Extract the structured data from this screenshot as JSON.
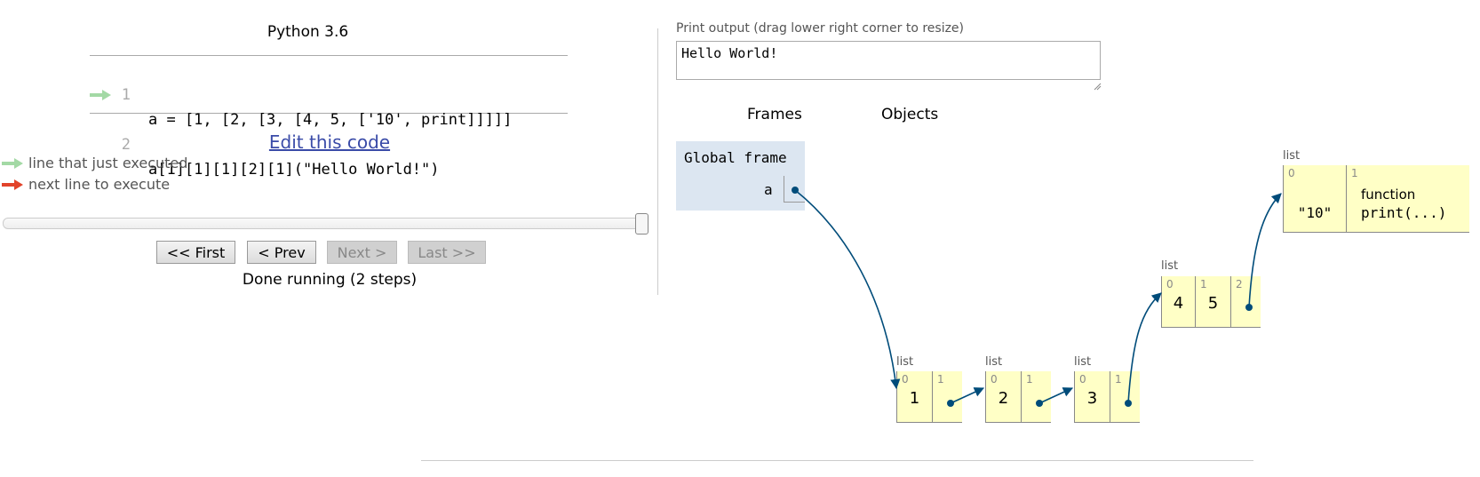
{
  "editor": {
    "language": "Python 3.6",
    "lines": [
      {
        "num": "1",
        "text": "a = [1, [2, [3, [4, 5, ['10', print]]]]]"
      },
      {
        "num": "2",
        "text": "a[1][1][1][2][1](\"Hello World!\")"
      }
    ],
    "edit_link": "Edit this code"
  },
  "legend": {
    "executed": "line that just executed",
    "next": "next line to execute",
    "executed_color": "#a3d9a5",
    "next_color": "#e2432a"
  },
  "nav": {
    "first": "<< First",
    "prev": "< Prev",
    "next": "Next >",
    "last": "Last >>",
    "status": "Done running (2 steps)"
  },
  "output": {
    "label": "Print output (drag lower right corner to resize)",
    "text": "Hello World!"
  },
  "viz": {
    "frames_header": "Frames",
    "objects_header": "Objects",
    "global_frame": "Global frame",
    "variable": "a",
    "list_tag": "list",
    "lists": [
      {
        "cells": [
          {
            "index": "0",
            "value": "1"
          },
          {
            "index": "1",
            "value": ""
          }
        ]
      },
      {
        "cells": [
          {
            "index": "0",
            "value": "2"
          },
          {
            "index": "1",
            "value": ""
          }
        ]
      },
      {
        "cells": [
          {
            "index": "0",
            "value": "3"
          },
          {
            "index": "1",
            "value": ""
          }
        ]
      },
      {
        "cells": [
          {
            "index": "0",
            "value": "4"
          },
          {
            "index": "1",
            "value": "5"
          },
          {
            "index": "2",
            "value": ""
          }
        ]
      },
      {
        "cells": [
          {
            "index": "0",
            "value": "\"10\""
          },
          {
            "index": "1",
            "value": "function",
            "sub": "print(...)"
          }
        ]
      }
    ],
    "pointer_color": "#004c7a"
  }
}
